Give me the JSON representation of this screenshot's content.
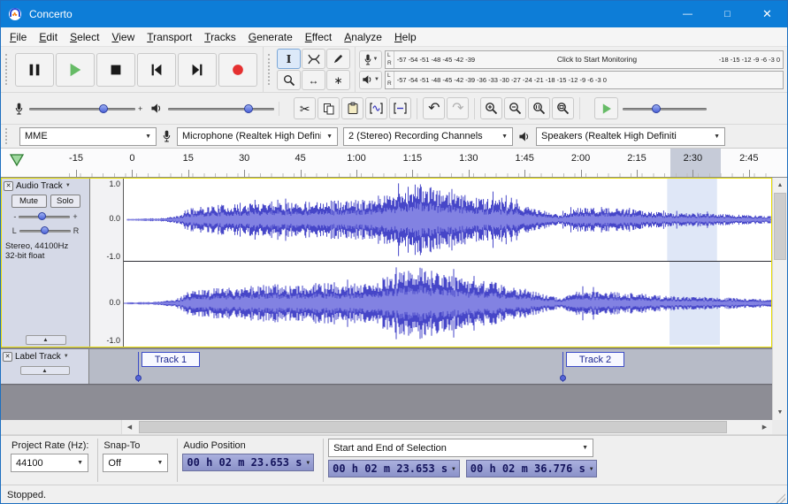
{
  "window": {
    "title": "Concerto"
  },
  "icons": {
    "minimize": "—",
    "maximize": "□",
    "close": "✕",
    "combo_arrow": "▼",
    "track_menu": "▼",
    "collapse": "▲",
    "scissors": "✂",
    "undo": "↶",
    "redo": "↷",
    "timeshift": "↔",
    "multitool": "∗",
    "left": "◀",
    "right": "▶",
    "up": "▲",
    "down": "▼",
    "plus": "+",
    "minus": "-",
    "ibeam": "I"
  },
  "menu": {
    "items": [
      "File",
      "Edit",
      "Select",
      "View",
      "Transport",
      "Tracks",
      "Generate",
      "Effect",
      "Analyze",
      "Help"
    ]
  },
  "meters": {
    "record": {
      "l": "L",
      "r": "R",
      "scale_left": "-57 -54 -51 -48 -45 -42 -39",
      "monitor": "Click to Start Monitoring",
      "scale_right": "-18 -15 -12 -9 -6 -3 0"
    },
    "playback": {
      "l": "L",
      "r": "R",
      "scale": "-57 -54 -51 -48 -45 -42 -39 -36 -33 -30 -27 -24 -21 -18 -15 -12 -9 -6 -3 0"
    }
  },
  "devices": {
    "host": "MME",
    "input": "Microphone (Realtek High Defini",
    "channels": "2 (Stereo) Recording Channels",
    "output": "Speakers (Realtek High Definiti"
  },
  "timeline": {
    "labels": [
      "-15",
      "0",
      "15",
      "30",
      "45",
      "1:00",
      "1:15",
      "1:30",
      "1:45",
      "2:00",
      "2:15",
      "2:30",
      "2:45"
    ]
  },
  "tracks": {
    "audio": {
      "name": "Audio Track",
      "mute": "Mute",
      "solo": "Solo",
      "gain": {
        "minus": "-",
        "plus": "+"
      },
      "pan": {
        "left": "L",
        "right": "R"
      },
      "info_line1": "Stereo, 44100Hz",
      "info_line2": "32-bit float",
      "ruler": [
        "1.0",
        "0.0",
        "-1.0"
      ]
    },
    "label": {
      "name": "Label Track",
      "labels": [
        "Track 1",
        "Track 2"
      ]
    }
  },
  "selection_bar": {
    "rate_label": "Project Rate (Hz):",
    "rate_value": "44100",
    "snap_label": "Snap-To",
    "snap_value": "Off",
    "position_label": "Audio Position",
    "position_value": "00 h 02 m 23.653 s",
    "range_mode": "Start and End of Selection",
    "sel_start": "00 h 02 m 23.653 s",
    "sel_end": "00 h 02 m 36.776 s"
  },
  "status": {
    "text": "Stopped."
  }
}
